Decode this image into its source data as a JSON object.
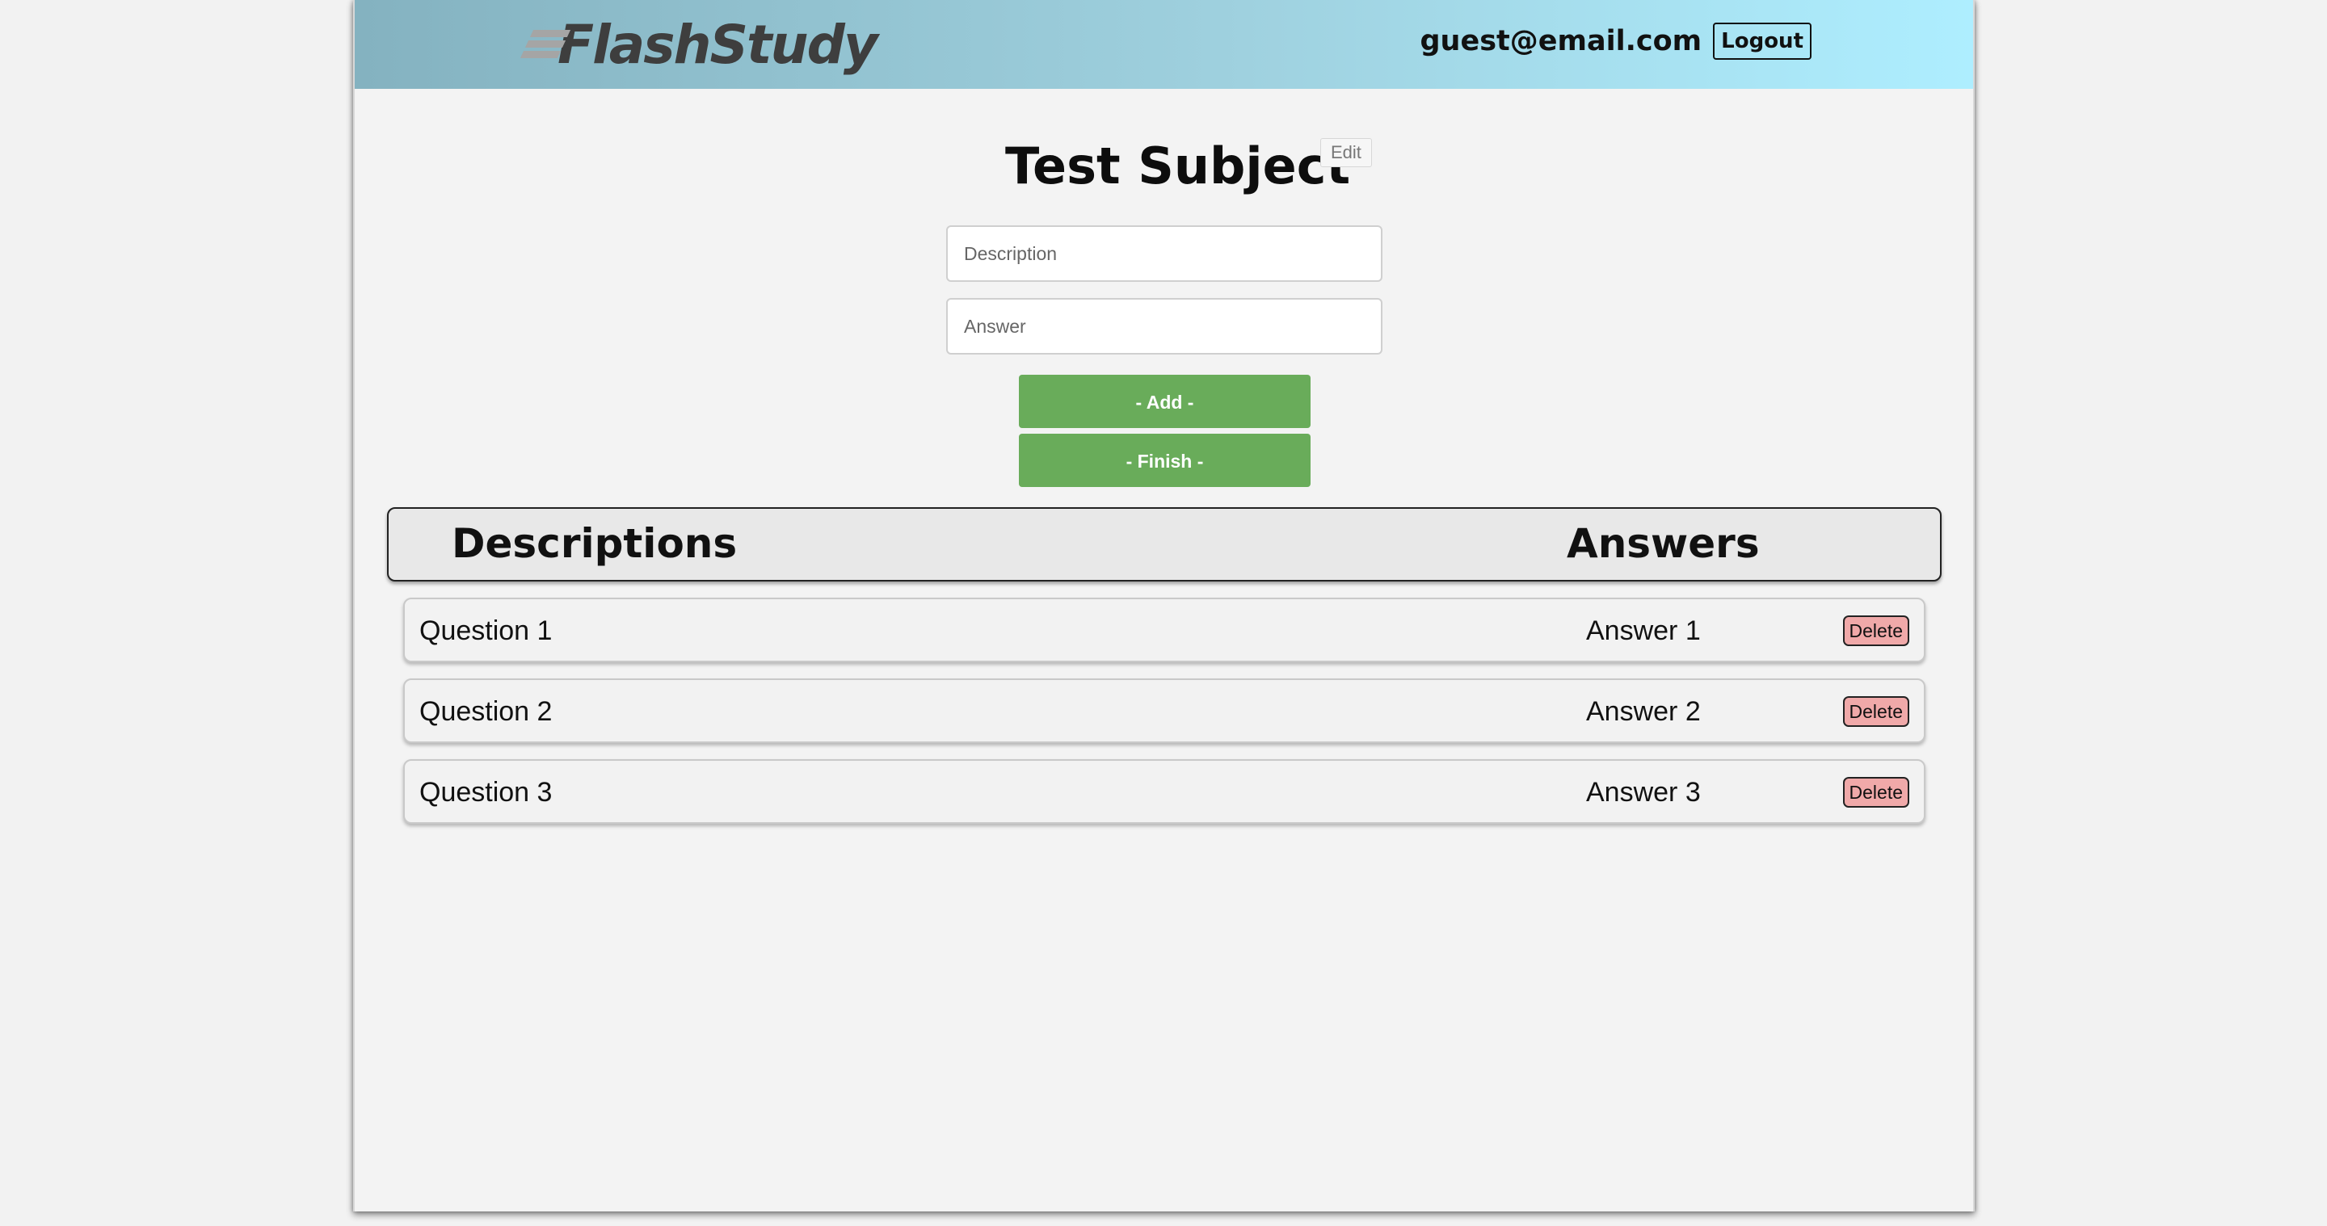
{
  "header": {
    "logo_text": "FlashStudy",
    "user_email": "guest@email.com",
    "logout_label": "Logout"
  },
  "subject": {
    "title": "Test Subject",
    "edit_label": "Edit"
  },
  "form": {
    "description_placeholder": "Description",
    "description_value": "",
    "answer_placeholder": "Answer",
    "answer_value": "",
    "add_label": "- Add -",
    "finish_label": "- Finish -"
  },
  "table": {
    "descriptions_header": "Descriptions",
    "answers_header": "Answers",
    "delete_label": "Delete",
    "rows": [
      {
        "question": "Question 1",
        "answer": "Answer 1"
      },
      {
        "question": "Question 2",
        "answer": "Answer 2"
      },
      {
        "question": "Question 3",
        "answer": "Answer 3"
      }
    ]
  },
  "colors": {
    "header_gradient_start": "#84b2c0",
    "header_gradient_end": "#aeeeff",
    "primary_button": "#69ac5a",
    "delete_button": "#f0a9a9"
  }
}
